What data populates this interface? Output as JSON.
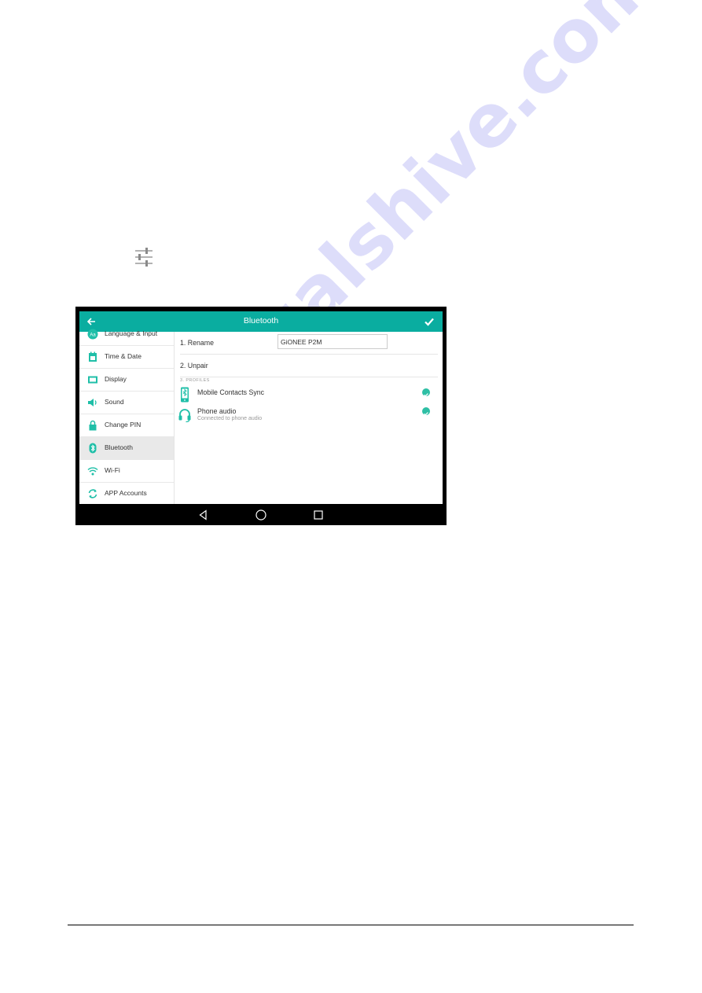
{
  "document": {
    "watermark": "manualshive.com"
  },
  "screen": {
    "title": "Bluetooth",
    "back_icon": "arrow-left-icon",
    "confirm_icon": "checkmark-icon",
    "colors": {
      "accent": "#0aada0",
      "check": "#2ebfa5",
      "active_item_bg": "#e9e9e9",
      "navbar": "#000000"
    },
    "sidebar": {
      "items": [
        {
          "label": "Language & Input",
          "icon": "language-icon",
          "active": false
        },
        {
          "label": "Time & Date",
          "icon": "calendar-icon",
          "active": false
        },
        {
          "label": "Display",
          "icon": "display-icon",
          "active": false
        },
        {
          "label": "Sound",
          "icon": "speaker-icon",
          "active": false
        },
        {
          "label": "Change PIN",
          "icon": "lock-icon",
          "active": false
        },
        {
          "label": "Bluetooth",
          "icon": "bluetooth-icon",
          "active": true
        },
        {
          "label": "Wi-Fi",
          "icon": "wifi-icon",
          "active": false
        },
        {
          "label": "APP Accounts",
          "icon": "sync-icon",
          "active": false
        }
      ]
    },
    "content": {
      "rename_label": "1. Rename",
      "rename_value": "GiONEE P2M",
      "unpair_label": "2. Unpair",
      "profiles_header": "3. PROFILES",
      "profiles": [
        {
          "name": "Mobile Contacts Sync",
          "subtitle": "",
          "icon": "phone-bluetooth-icon",
          "enabled": true
        },
        {
          "name": "Phone audio",
          "subtitle": "Connected to phone audio",
          "icon": "headphones-icon",
          "enabled": true
        }
      ]
    },
    "navbar": {
      "buttons": [
        "back-nav-icon",
        "home-nav-icon",
        "recents-nav-icon"
      ]
    }
  }
}
